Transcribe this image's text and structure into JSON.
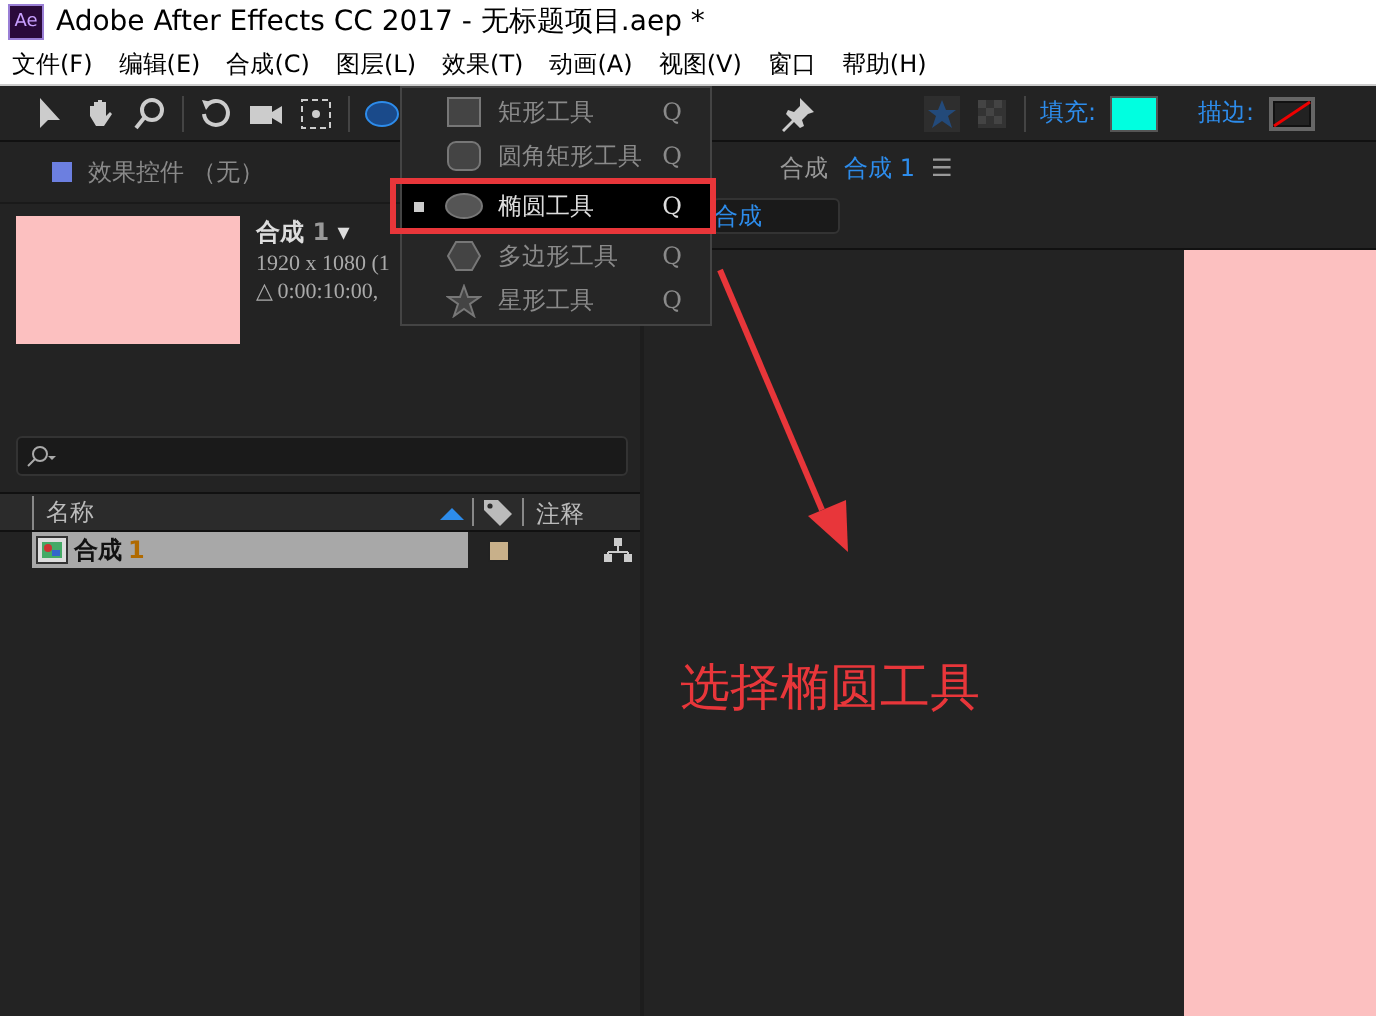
{
  "window": {
    "title": "Adobe After Effects CC 2017 - 无标题项目.aep *",
    "app_badge": "Ae"
  },
  "menu_bar": [
    "文件(F)",
    "编辑(E)",
    "合成(C)",
    "图层(L)",
    "效果(T)",
    "动画(A)",
    "视图(V)",
    "窗口",
    "帮助(H)"
  ],
  "toolbar": {
    "fill_label": "填充:",
    "stroke_label": "描边:"
  },
  "shape_menu": [
    {
      "label": "矩形工具",
      "shortcut": "Q",
      "kind": "rect",
      "selected": false
    },
    {
      "label": "圆角矩形工具",
      "shortcut": "Q",
      "kind": "rounded",
      "selected": false
    },
    {
      "label": "椭圆工具",
      "shortcut": "Q",
      "kind": "ellipse",
      "selected": true
    },
    {
      "label": "多边形工具",
      "shortcut": "Q",
      "kind": "polygon",
      "selected": false
    },
    {
      "label": "星形工具",
      "shortcut": "Q",
      "kind": "star",
      "selected": false
    }
  ],
  "effects_panel": {
    "title": "效果控件 （无）"
  },
  "project_panel": {
    "comp_name": "合成",
    "comp_number": "1",
    "dropdown_glyph": "▾",
    "resolution": "1920 x 1080 (1",
    "duration": "△ 0:00:10:00,",
    "columns": [
      "名称",
      "注释"
    ],
    "rows": [
      {
        "name": "合成",
        "number": "1",
        "selected": true
      }
    ]
  },
  "comp_panel": {
    "label": "合成",
    "tab": "合成",
    "tab_number": "1",
    "menu_glyph": "☰",
    "breadcrumb": "合成"
  },
  "annotation": {
    "text": "选择椭圆工具"
  }
}
